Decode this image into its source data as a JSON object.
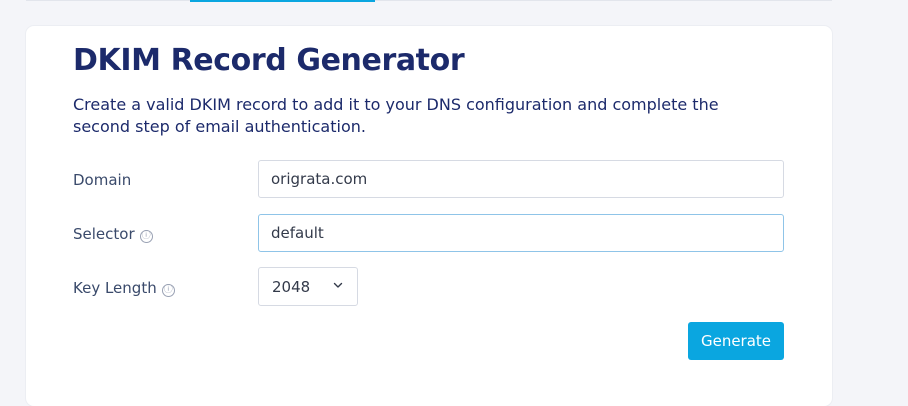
{
  "header": {
    "title": "DKIM Record Generator",
    "description": "Create a valid DKIM record to add it to your DNS configuration and complete the second step of email authentication."
  },
  "form": {
    "domain": {
      "label": "Domain",
      "value": "origrata.com"
    },
    "selector": {
      "label": "Selector",
      "value": "default",
      "info_icon": "ⓘ"
    },
    "key_length": {
      "label": "Key Length",
      "selected": "2048",
      "info_icon": "ⓘ"
    },
    "generate_label": "Generate"
  },
  "colors": {
    "accent": "#0aa6e0",
    "title": "#1c2a6b",
    "page_background": "#f4f5f9"
  }
}
